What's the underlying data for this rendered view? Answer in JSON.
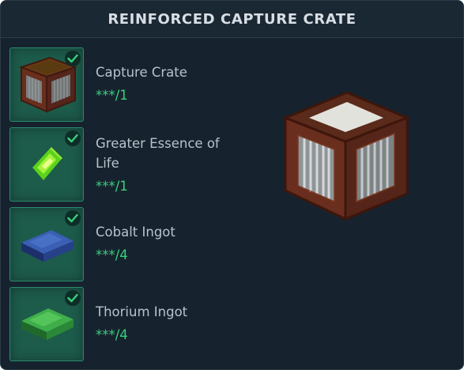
{
  "header": {
    "title": "REINFORCED CAPTURE CRATE"
  },
  "ingredients": [
    {
      "name": "Capture Crate",
      "quantity": "***/1",
      "completed": true,
      "icon": "capture-crate-icon"
    },
    {
      "name": "Greater Essence of Life",
      "quantity": "***/1",
      "completed": true,
      "icon": "greater-essence-of-life-icon"
    },
    {
      "name": "Cobalt Ingot",
      "quantity": "***/4",
      "completed": true,
      "icon": "cobalt-ingot-icon"
    },
    {
      "name": "Thorium Ingot",
      "quantity": "***/4",
      "completed": true,
      "icon": "thorium-ingot-icon"
    }
  ],
  "preview": {
    "icon": "reinforced-capture-crate-icon"
  },
  "colors": {
    "background": "#16232e",
    "slot": "#1d5b4b",
    "slot_border": "#2c8a6e",
    "check": "#39d07e",
    "quantity_text": "#39d07e",
    "name_text": "#b8c2cb",
    "title_text": "#d8dee4"
  }
}
